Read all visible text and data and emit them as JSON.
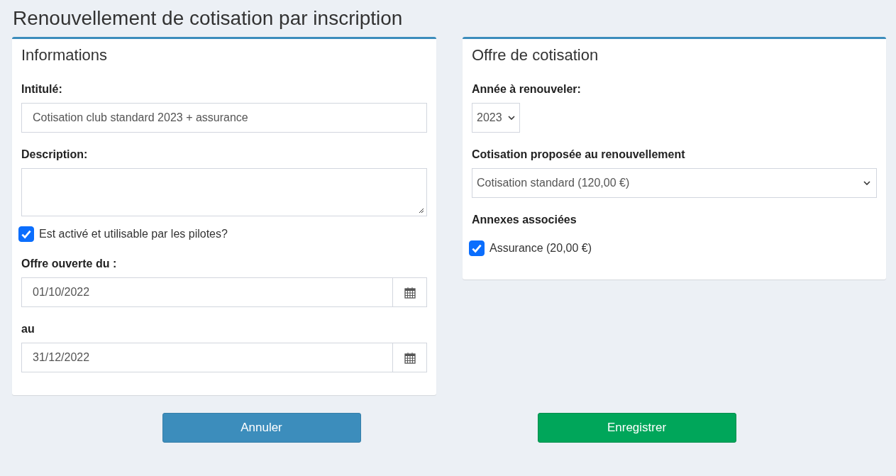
{
  "title": "Renouvellement de cotisation par inscription",
  "informations": {
    "heading": "Informations",
    "intitule": {
      "label": "Intitulé:",
      "value": "Cotisation club standard 2023 + assurance"
    },
    "description": {
      "label": "Description:"
    },
    "active": {
      "label": "Est activé et utilisable par les pilotes?",
      "checked": true
    },
    "date_from": {
      "label": "Offre ouverte du :",
      "value": "01/10/2022"
    },
    "date_to": {
      "label": "au",
      "value": "31/12/2022"
    }
  },
  "offre": {
    "heading": "Offre de cotisation",
    "annee": {
      "label": "Année à renouveler:",
      "value": "2023"
    },
    "cotisation": {
      "label": "Cotisation proposée au renouvellement",
      "value": "Cotisation standard (120,00 €)"
    },
    "annexes": {
      "label": "Annexes associées",
      "items": [
        {
          "label": "Assurance (20,00 €)",
          "checked": true
        }
      ]
    }
  },
  "buttons": [
    {
      "label": "Annuler",
      "kind": "cancel"
    },
    {
      "label": "Enregistrer",
      "kind": "save"
    }
  ]
}
